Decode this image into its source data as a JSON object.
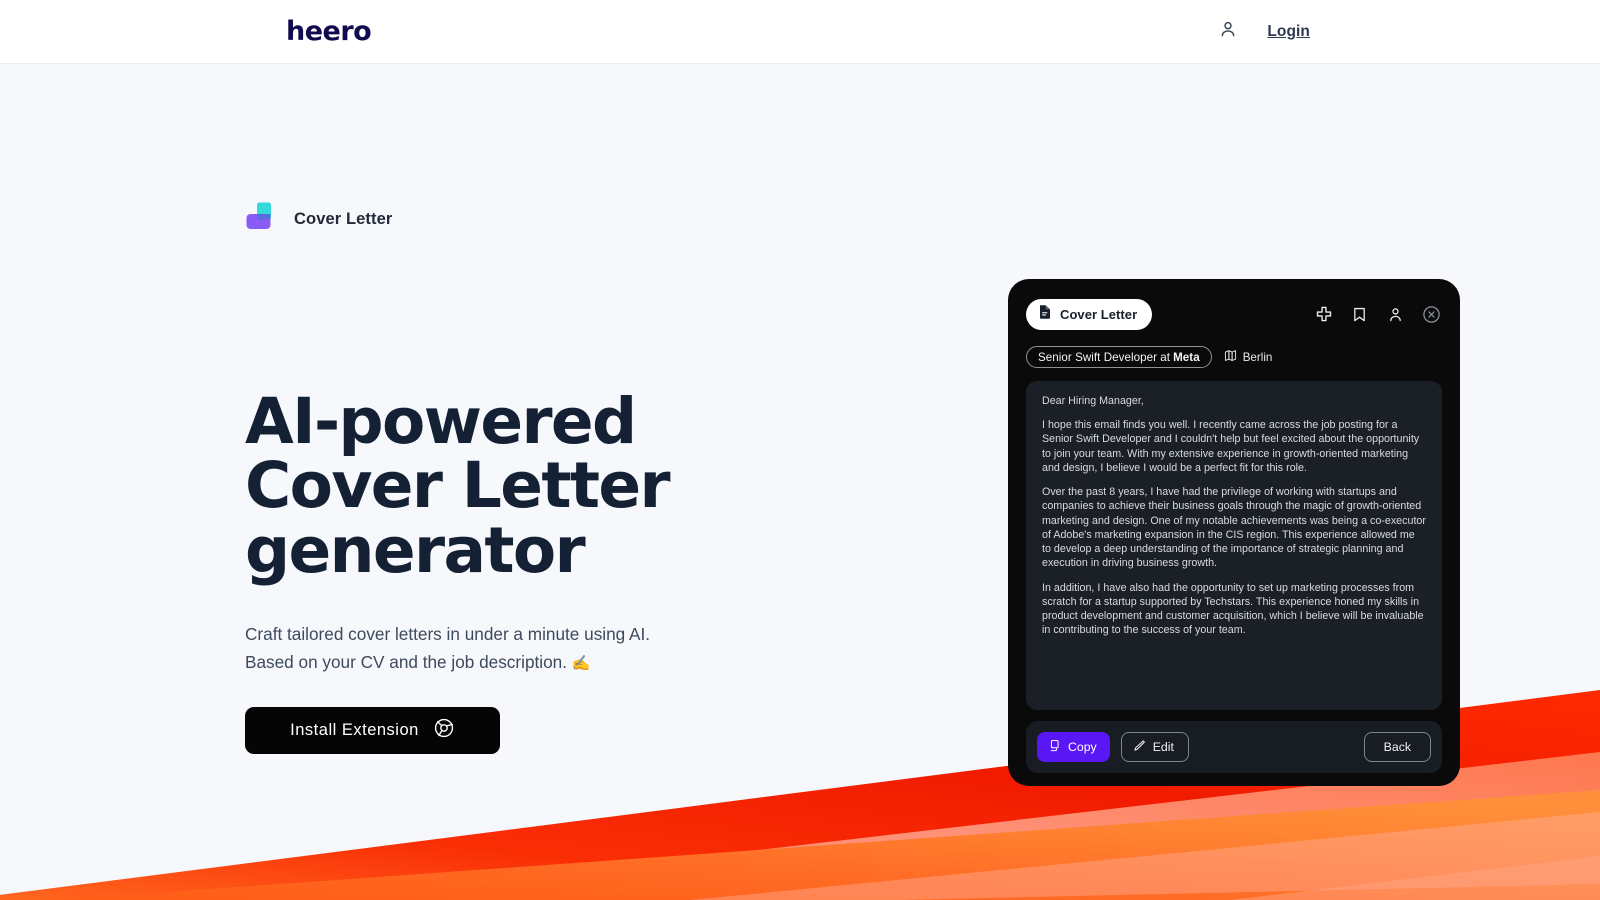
{
  "header": {
    "logo_text": "heero",
    "user_icon": "user-icon",
    "login_label": "Login"
  },
  "hero": {
    "badge": {
      "logo_icon": "cover-letter-logo-icon",
      "label": "Cover Letter"
    },
    "title": "AI-powered Cover Letter generator",
    "subtitle_line1": "Craft tailored cover letters in under a minute using AI.",
    "subtitle_line2": "Based on your CV and the job description.",
    "subtitle_emoji": "✍️",
    "cta": {
      "label": "Install Extension",
      "icon": "chrome-browser-icon"
    }
  },
  "widget": {
    "title_pill": {
      "icon": "document-icon",
      "label": "Cover Letter"
    },
    "actions": [
      {
        "name": "plus-icon",
        "tooltip": "Add"
      },
      {
        "name": "bookmark-icon",
        "tooltip": "Save"
      },
      {
        "name": "user-icon",
        "tooltip": "Profile"
      },
      {
        "name": "close-circle-icon",
        "tooltip": "Close"
      }
    ],
    "job": {
      "prefix": "Senior Swift Developer at",
      "company": "Meta",
      "location": "Berlin",
      "location_icon": "map-icon"
    },
    "letter": {
      "salutation": "Dear Hiring Manager,",
      "paragraphs": [
        "I hope this email finds you well. I recently came across the job posting for a Senior Swift Developer and I couldn't help but feel excited about the opportunity to join your team. With my extensive experience in growth-oriented marketing and design, I believe I would be a perfect fit for this role.",
        "Over the past 8 years, I have had the privilege of working with startups and companies to achieve their business goals through the magic of growth-oriented marketing and design. One of my notable achievements was being a co-executor of Adobe's marketing expansion in the CIS region. This experience allowed me to develop a deep understanding of the importance of strategic planning and execution in driving business growth.",
        "In addition, I have also had the opportunity to set up marketing processes from scratch for a startup supported by Techstars. This experience honed my skills in product development and customer acquisition, which I believe will be invaluable in contributing to the success of your team."
      ]
    },
    "footer": {
      "copy_label": "Copy",
      "copy_icon": "copy-icon",
      "edit_label": "Edit",
      "edit_icon": "pencil-icon",
      "back_label": "Back"
    }
  },
  "colors": {
    "page_background": "#F7F8FC",
    "logo_navy": "#110A4E",
    "heading_navy": "#142033",
    "accent_purple": "#5A17F5",
    "widget_black": "#0A0A0B",
    "widget_panel": "#1B2027",
    "ribbon_red": "#F42000",
    "ribbon_orange": "#FF7A2B",
    "ribbon_salmon": "#FF8E72",
    "badge_cyan": "#35D8DC",
    "badge_purple": "#8A5CF6"
  }
}
